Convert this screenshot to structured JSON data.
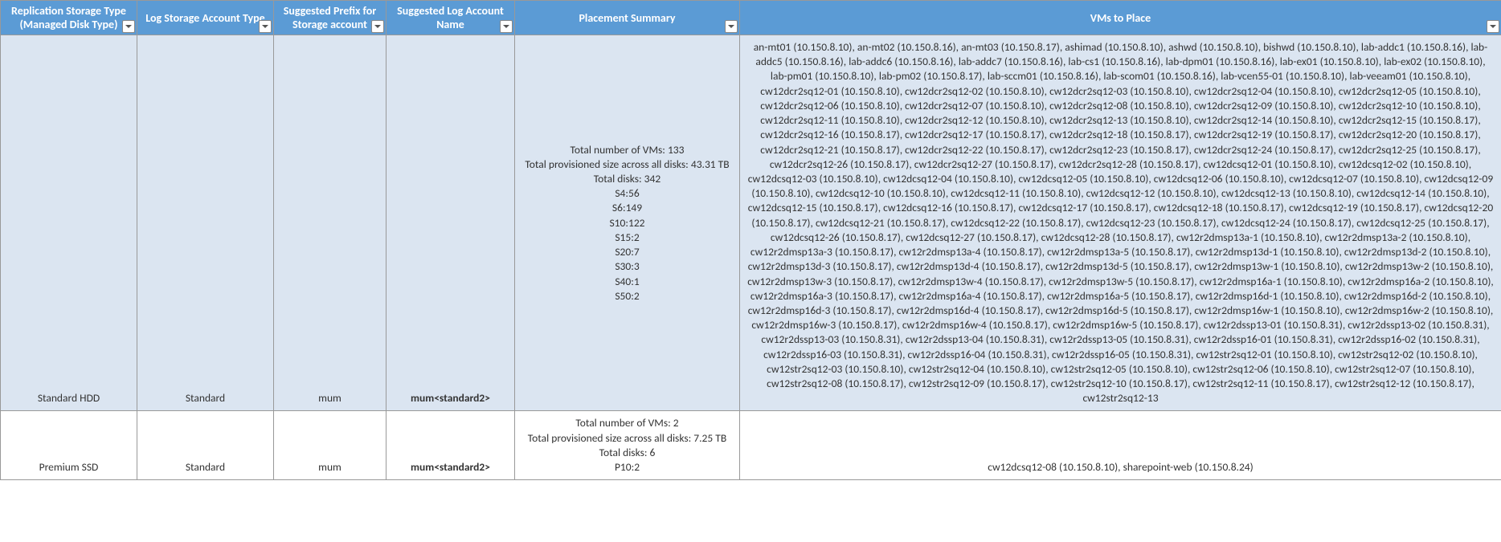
{
  "headers": {
    "replication": "Replication Storage Type (Managed Disk Type)",
    "logType": "Log Storage Account Type",
    "prefix": "Suggested Prefix for Storage account",
    "suggestedLog": "Suggested Log Account Name",
    "placement": "Placement Summary",
    "vms": "VMs to Place"
  },
  "rows": [
    {
      "replication": "Standard HDD",
      "logType": "Standard",
      "prefix": "mum",
      "suggestedLog": "mum<standard2>",
      "summary": [
        "Total number of VMs: 133",
        "Total provisioned size across all disks: 43.31 TB",
        "Total disks: 342",
        "S4:56",
        "S6:149",
        "S10:122",
        "S15:2",
        "S20:7",
        "S30:3",
        "S40:1",
        "S50:2"
      ],
      "vms": "an-mt01 (10.150.8.10), an-mt02 (10.150.8.16), an-mt03 (10.150.8.17), ashimad (10.150.8.10), ashwd (10.150.8.10), bishwd (10.150.8.10), lab-addc1 (10.150.8.16), lab-addc5 (10.150.8.16), lab-addc6 (10.150.8.16), lab-addc7 (10.150.8.16), lab-cs1 (10.150.8.16), lab-dpm01 (10.150.8.16), lab-ex01 (10.150.8.10), lab-ex02 (10.150.8.10), lab-pm01 (10.150.8.10), lab-pm02 (10.150.8.17), lab-sccm01 (10.150.8.16), lab-scom01 (10.150.8.16), lab-vcen55-01 (10.150.8.10), lab-veeam01 (10.150.8.10), cw12dcr2sq12-01 (10.150.8.10), cw12dcr2sq12-02 (10.150.8.10), cw12dcr2sq12-03 (10.150.8.10), cw12dcr2sq12-04 (10.150.8.10), cw12dcr2sq12-05 (10.150.8.10), cw12dcr2sq12-06 (10.150.8.10), cw12dcr2sq12-07 (10.150.8.10), cw12dcr2sq12-08 (10.150.8.10), cw12dcr2sq12-09 (10.150.8.10), cw12dcr2sq12-10 (10.150.8.10), cw12dcr2sq12-11 (10.150.8.10), cw12dcr2sq12-12 (10.150.8.10), cw12dcr2sq12-13 (10.150.8.10), cw12dcr2sq12-14 (10.150.8.10), cw12dcr2sq12-15 (10.150.8.17), cw12dcr2sq12-16 (10.150.8.17), cw12dcr2sq12-17 (10.150.8.17), cw12dcr2sq12-18 (10.150.8.17), cw12dcr2sq12-19 (10.150.8.17), cw12dcr2sq12-20 (10.150.8.17), cw12dcr2sq12-21 (10.150.8.17), cw12dcr2sq12-22 (10.150.8.17), cw12dcr2sq12-23 (10.150.8.17), cw12dcr2sq12-24 (10.150.8.17), cw12dcr2sq12-25 (10.150.8.17), cw12dcr2sq12-26 (10.150.8.17), cw12dcr2sq12-27 (10.150.8.17), cw12dcr2sq12-28 (10.150.8.17), cw12dcsq12-01 (10.150.8.10), cw12dcsq12-02 (10.150.8.10), cw12dcsq12-03 (10.150.8.10), cw12dcsq12-04 (10.150.8.10), cw12dcsq12-05 (10.150.8.10), cw12dcsq12-06 (10.150.8.10), cw12dcsq12-07 (10.150.8.10), cw12dcsq12-09 (10.150.8.10), cw12dcsq12-10 (10.150.8.10), cw12dcsq12-11 (10.150.8.10), cw12dcsq12-12 (10.150.8.10), cw12dcsq12-13 (10.150.8.10), cw12dcsq12-14 (10.150.8.10), cw12dcsq12-15 (10.150.8.17), cw12dcsq12-16 (10.150.8.17), cw12dcsq12-17 (10.150.8.17), cw12dcsq12-18 (10.150.8.17), cw12dcsq12-19 (10.150.8.17), cw12dcsq12-20 (10.150.8.17), cw12dcsq12-21 (10.150.8.17), cw12dcsq12-22 (10.150.8.17), cw12dcsq12-23 (10.150.8.17), cw12dcsq12-24 (10.150.8.17), cw12dcsq12-25 (10.150.8.17), cw12dcsq12-26 (10.150.8.17), cw12dcsq12-27 (10.150.8.17), cw12dcsq12-28 (10.150.8.17), cw12r2dmsp13a-1 (10.150.8.10), cw12r2dmsp13a-2 (10.150.8.10), cw12r2dmsp13a-3 (10.150.8.17), cw12r2dmsp13a-4 (10.150.8.17), cw12r2dmsp13a-5 (10.150.8.17), cw12r2dmsp13d-1 (10.150.8.10), cw12r2dmsp13d-2 (10.150.8.10), cw12r2dmsp13d-3 (10.150.8.17), cw12r2dmsp13d-4 (10.150.8.17), cw12r2dmsp13d-5 (10.150.8.17), cw12r2dmsp13w-1 (10.150.8.10), cw12r2dmsp13w-2 (10.150.8.10), cw12r2dmsp13w-3 (10.150.8.17), cw12r2dmsp13w-4 (10.150.8.17), cw12r2dmsp13w-5 (10.150.8.17), cw12r2dmsp16a-1 (10.150.8.10), cw12r2dmsp16a-2 (10.150.8.10), cw12r2dmsp16a-3 (10.150.8.17), cw12r2dmsp16a-4 (10.150.8.17), cw12r2dmsp16a-5 (10.150.8.17), cw12r2dmsp16d-1 (10.150.8.10), cw12r2dmsp16d-2 (10.150.8.10), cw12r2dmsp16d-3 (10.150.8.17), cw12r2dmsp16d-4 (10.150.8.17), cw12r2dmsp16d-5 (10.150.8.17), cw12r2dmsp16w-1 (10.150.8.10), cw12r2dmsp16w-2 (10.150.8.10), cw12r2dmsp16w-3 (10.150.8.17), cw12r2dmsp16w-4 (10.150.8.17), cw12r2dmsp16w-5 (10.150.8.17), cw12r2dssp13-01 (10.150.8.31), cw12r2dssp13-02 (10.150.8.31), cw12r2dssp13-03 (10.150.8.31), cw12r2dssp13-04 (10.150.8.31), cw12r2dssp13-05 (10.150.8.31), cw12r2dssp16-01 (10.150.8.31), cw12r2dssp16-02 (10.150.8.31), cw12r2dssp16-03 (10.150.8.31), cw12r2dssp16-04 (10.150.8.31), cw12r2dssp16-05 (10.150.8.31), cw12str2sq12-01 (10.150.8.10), cw12str2sq12-02 (10.150.8.10), cw12str2sq12-03 (10.150.8.10), cw12str2sq12-04 (10.150.8.10), cw12str2sq12-05 (10.150.8.10), cw12str2sq12-06 (10.150.8.10), cw12str2sq12-07 (10.150.8.10), cw12str2sq12-08 (10.150.8.17), cw12str2sq12-09 (10.150.8.17), cw12str2sq12-10 (10.150.8.17), cw12str2sq12-11 (10.150.8.17), cw12str2sq12-12 (10.150.8.17), cw12str2sq12-13"
    },
    {
      "replication": "Premium SSD",
      "logType": "Standard",
      "prefix": "mum",
      "suggestedLog": "mum<standard2>",
      "summary": [
        "Total number of VMs: 2",
        "Total provisioned size across all disks: 7.25 TB",
        "Total disks: 6",
        "P10:2"
      ],
      "vms": "cw12dcsq12-08 (10.150.8.10), sharepoint-web (10.150.8.24)"
    }
  ]
}
